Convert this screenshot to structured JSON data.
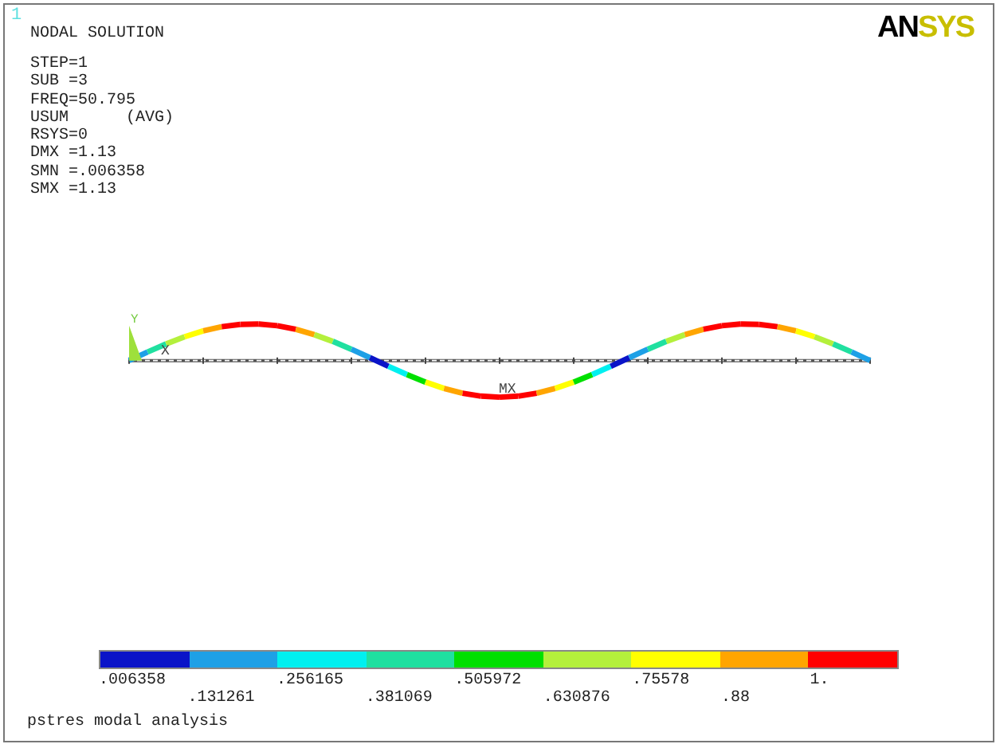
{
  "window_number": "1",
  "logo_parts": [
    "AN",
    "SYS"
  ],
  "info_title": "NODAL SOLUTION",
  "info_lines": [
    "STEP=1",
    "SUB =3",
    "FREQ=50.795",
    "USUM      (AVG)",
    "RSYS=0",
    "DMX =1.13",
    "SMN =.006358",
    "SMX =1.13"
  ],
  "plot": {
    "axis_labels": [
      "Y",
      "X"
    ],
    "max_label": "MX"
  },
  "legend": [
    {
      "label": ".006358",
      "color": "#0a14c8"
    },
    {
      "label": ".131261",
      "color": "#1ea0e6"
    },
    {
      "label": ".256165",
      "color": "#00f0f0"
    },
    {
      "label": ".381069",
      "color": "#20e0a0"
    },
    {
      "label": ".505972",
      "color": "#00e000"
    },
    {
      "label": ".630876",
      "color": "#b4f03c"
    },
    {
      "label": ".75578",
      "color": "#ffff00"
    },
    {
      "label": ".88",
      "color": "#ffa500"
    },
    {
      "label": "1.",
      "color": "#ff0000"
    }
  ],
  "footer": "pstres modal analysis"
}
